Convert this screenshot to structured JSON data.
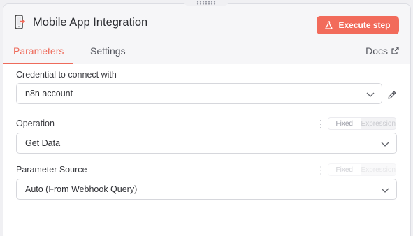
{
  "header": {
    "title": "Mobile App Integration",
    "execute_label": "Execute step",
    "accent_color": "#f26b5b"
  },
  "tabs": {
    "parameters": "Parameters",
    "settings": "Settings",
    "docs": "Docs"
  },
  "fields": {
    "credential": {
      "label": "Credential to connect with",
      "value": "n8n account"
    },
    "operation": {
      "label": "Operation",
      "value": "Get Data",
      "mode_fixed": "Fixed",
      "mode_expression": "Expression"
    },
    "parameter_source": {
      "label": "Parameter Source",
      "value": "Auto (From Webhook Query)",
      "mode_fixed": "Fixed",
      "mode_expression": "Expression"
    }
  }
}
